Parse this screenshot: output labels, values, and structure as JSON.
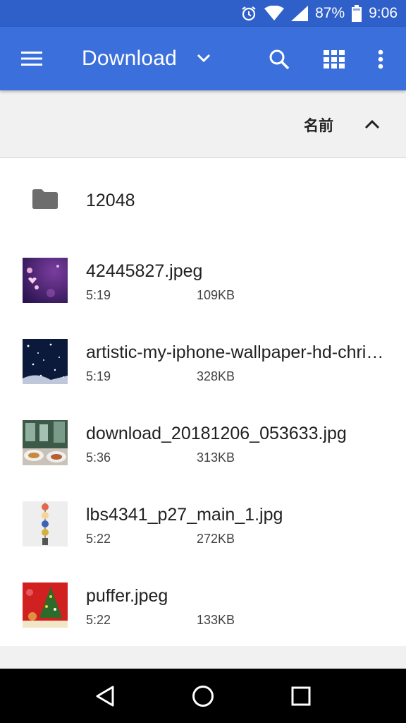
{
  "status_bar": {
    "battery": "87%",
    "time": "9:06",
    "icons": [
      "alarm-icon",
      "wifi-icon",
      "signal-icon",
      "battery-icon"
    ]
  },
  "app_bar": {
    "title": "Download",
    "icons": [
      "menu-icon",
      "chevron-down-icon",
      "search-icon",
      "grid-view-icon",
      "more-vert-icon"
    ],
    "color": "#3b6fdc"
  },
  "sort_bar": {
    "label": "名前",
    "direction_icon": "chevron-up-icon"
  },
  "files": [
    {
      "name": "12048",
      "type": "folder",
      "time": "",
      "size": ""
    },
    {
      "name": "42445827.jpeg",
      "type": "image",
      "time": "5:19",
      "size": "109KB"
    },
    {
      "name": "artistic-my-iphone-wallpaper-hd-chri…",
      "type": "image",
      "time": "5:19",
      "size": "328KB"
    },
    {
      "name": "download_20181206_053633.jpg",
      "type": "image",
      "time": "5:36",
      "size": "313KB"
    },
    {
      "name": "lbs4341_p27_main_1.jpg",
      "type": "image",
      "time": "5:22",
      "size": "272KB"
    },
    {
      "name": "puffer.jpeg",
      "type": "image",
      "time": "5:22",
      "size": "133KB"
    }
  ],
  "nav_bar": {
    "icons": [
      "back-icon",
      "home-icon",
      "recents-icon"
    ]
  }
}
